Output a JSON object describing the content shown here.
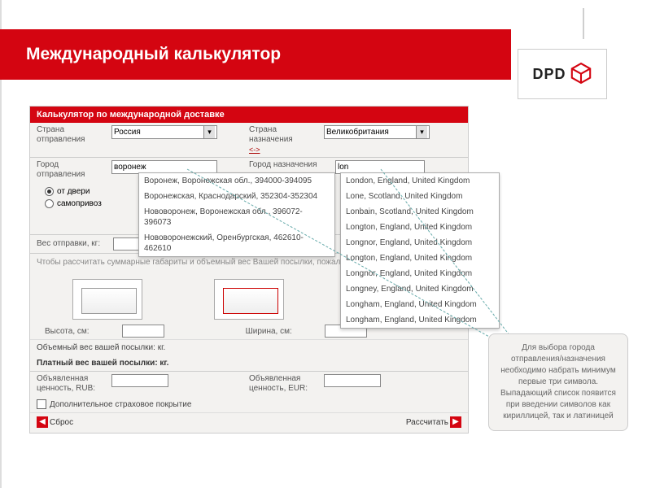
{
  "banner": {
    "title": "Международный калькулятор"
  },
  "logo": {
    "text": "DPD"
  },
  "panel": {
    "header": "Калькулятор по международной доставке",
    "country_from_label": "Страна отправления",
    "country_from_value": "Россия",
    "country_to_label": "Страна назначения",
    "country_to_value": "Великобритания",
    "swap_label": "<->",
    "city_from_label": "Город отправления",
    "city_from_value": "воронеж",
    "city_to_label": "Город назначения",
    "city_to_value": "lon",
    "radio_from_door": "от двери",
    "radio_self": "самопривоз",
    "weight_label": "Вес отправки, кг:",
    "dims_note": "Чтобы рассчитать суммарные габариты и объемный вес Вашей посылки, пожалуйста заполните три поля",
    "height_label": "Высота, см:",
    "width_label": "Ширина, см:",
    "volumetric_label": "Объемный вес вашей посылки:  кг.",
    "paid_weight_label": "Платный вес вашей посылки:  кг.",
    "declared_rub_label": "Объявленная ценность, RUB:",
    "declared_eur_label": "Объявленная ценность, EUR:",
    "extra_insurance_label": "Дополнительное страховое покрытие",
    "reset_label": "Сброс",
    "calc_label": "Рассчитать"
  },
  "autocomplete_from": [
    "Воронеж, Воронежская обл., 394000-394095",
    "Воронежская, Краснодарский, 352304-352304",
    "Нововоронеж, Воронежская обл., 396072-396073",
    "Нововоронежский, Оренбургская, 462610-462610"
  ],
  "autocomplete_to": [
    "London, England, United Kingdom",
    "Lone, Scotland, United Kingdom",
    "Lonbain, Scotland, United Kingdom",
    "Longton, England, United Kingdom",
    "Longnor, England, United Kingdom",
    "Longton, England, United Kingdom",
    "Longnor, England, United Kingdom",
    "Longney, England, United Kingdom",
    "Longham, England, United Kingdom",
    "Longham, England, United Kingdom"
  ],
  "callout": {
    "text": "Для выбора города отправления/назначения необходимо набрать минимум первые три символа. Выпадающий список появится при введении символов как кириллицей, так и латиницей"
  }
}
